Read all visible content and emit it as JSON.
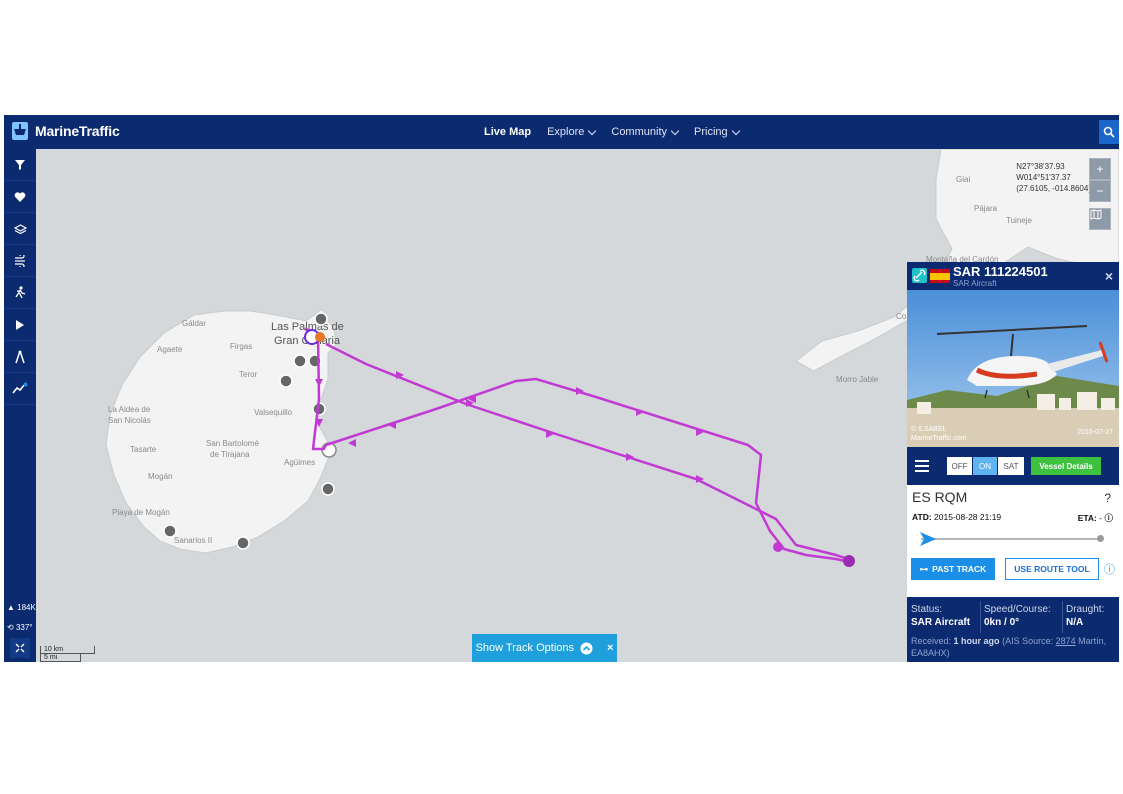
{
  "app": {
    "name": "MarineTraffic"
  },
  "nav": {
    "items": [
      {
        "label": "Live Map",
        "active": true,
        "dropdown": false
      },
      {
        "label": "Explore",
        "active": false,
        "dropdown": true
      },
      {
        "label": "Community",
        "active": false,
        "dropdown": true
      },
      {
        "label": "Pricing",
        "active": false,
        "dropdown": true
      }
    ]
  },
  "sidebar": {
    "tools": [
      "filter-icon",
      "heart-icon",
      "layers-icon",
      "wind-icon",
      "person-icon",
      "play-icon",
      "measure-icon",
      "track-icon"
    ],
    "vessels_count": "184K",
    "heading_value": "337°"
  },
  "map": {
    "coords": {
      "lat": "N27°38'37.93",
      "lon": "W014°51'37.37",
      "decimal": "(27.6105, -014.8604)"
    },
    "zoom_in": "+",
    "zoom_out": "−",
    "place_labels": {
      "galdar": "Gáldar",
      "agaete": "Agaete",
      "firgas": "Firgas",
      "las_palmas_1": "Las Palmas de",
      "las_palmas_2": "Gran Canaria",
      "teror": "Teror",
      "valsequillo": "Valsequillo",
      "la_aldea_1": "La Aldea de",
      "la_aldea_2": "San Nicolás",
      "san_bartolome_1": "San Bartolomé",
      "san_bartolome_2": "de Tirajana",
      "tasarte": "Tasarte",
      "aguimes": "Agüimes",
      "mogan": "Mogán",
      "playa_mogan": "Playa de Mogán",
      "sanarios": "Sanarios II",
      "pajara": "Pájara",
      "tuineje": "Tuineje",
      "montana": "Montaña del Cardón",
      "morro_jable": "Morro Jable",
      "giai": "Giai",
      "co": "Co"
    },
    "scale_km": "10 km",
    "scale_mi": "5 mi",
    "track_options_label": "Show Track Options"
  },
  "vessel": {
    "name": "SAR 111224501",
    "type": "SAR Aircraft",
    "flag": "Spain",
    "photo_credit_1": "© ILSABEL",
    "photo_credit_2": "MarineTraffic.com",
    "photo_date": "2016-07-27",
    "toggle": {
      "off": "OFF",
      "on": "ON",
      "sat": "SAT",
      "selected": "ON"
    },
    "details_button": "Vessel Details",
    "destination": "ES RQM",
    "atd_label": "ATD:",
    "atd_value": "2015-08-28 21:19",
    "eta_label": "ETA:",
    "eta_value": "-",
    "progress": 0,
    "past_track_button": "PAST TRACK",
    "route_tool_button": "USE ROUTE TOOL",
    "status_label": "Status:",
    "status_value": "SAR Aircraft",
    "speed_label": "Speed/Course:",
    "speed_value": "0kn / 0°",
    "draught_label": "Draught:",
    "draught_value": "N/A",
    "received_prefix": "Received:",
    "received_age": "1 hour ago",
    "received_source_prefix": "(AIS Source:",
    "received_source_id": "2874",
    "received_source_rest": "Martín, EA8AHX)"
  },
  "colors": {
    "navbar": "#0b2a6f",
    "accent": "#1b8ee8",
    "track": "#c23ad4",
    "green_button": "#3ec13e",
    "sea": "#d4d8da",
    "land": "#f3f3f3"
  }
}
